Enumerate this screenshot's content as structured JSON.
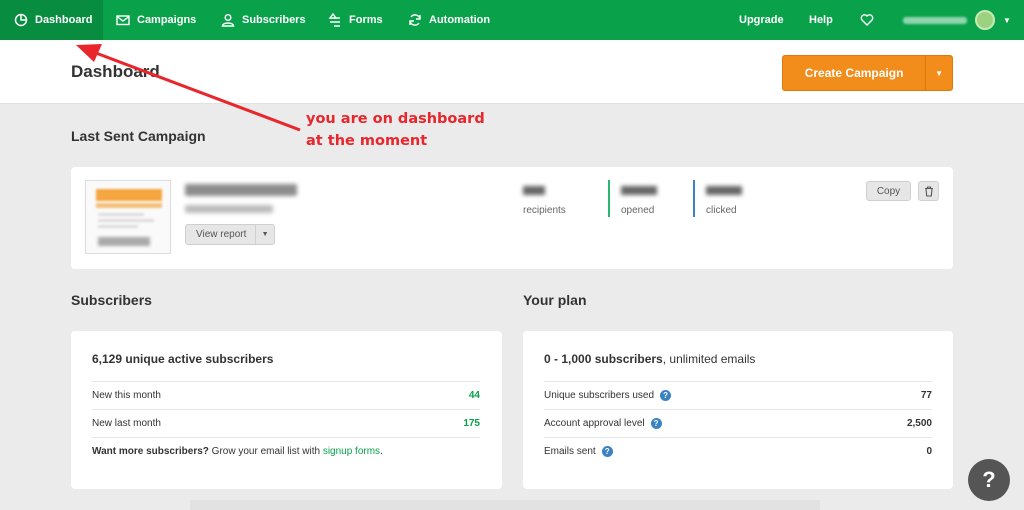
{
  "nav": {
    "items": [
      {
        "label": "Dashboard",
        "icon": "pie-chart-icon"
      },
      {
        "label": "Campaigns",
        "icon": "envelope-icon"
      },
      {
        "label": "Subscribers",
        "icon": "user-icon"
      },
      {
        "label": "Forms",
        "icon": "forms-icon"
      },
      {
        "label": "Automation",
        "icon": "sync-icon"
      }
    ],
    "upgrade": "Upgrade",
    "help": "Help",
    "heart_icon": "heart-icon",
    "caret_icon": "caret-down-icon"
  },
  "header": {
    "title": "Dashboard",
    "create_button": "Create Campaign"
  },
  "last_campaign": {
    "section_title": "Last Sent Campaign",
    "view_report": "View report",
    "stats": [
      {
        "label": "recipients",
        "color": "#ffffff"
      },
      {
        "label": "opened",
        "color": "#2bb673"
      },
      {
        "label": "clicked",
        "color": "#3b82c4"
      }
    ],
    "copy": "Copy"
  },
  "subscribers": {
    "section_title": "Subscribers",
    "headline": "6,129 unique active subscribers",
    "rows": [
      {
        "label": "New this month",
        "value": "44"
      },
      {
        "label": "New last month",
        "value": "175"
      }
    ],
    "cta_bold": "Want more subscribers?",
    "cta_text": " Grow your email list with ",
    "cta_link": "signup forms",
    "cta_end": "."
  },
  "plan": {
    "section_title": "Your plan",
    "headline_bold": "0 - 1,000 subscribers",
    "headline_rest": ", unlimited emails",
    "rows": [
      {
        "label": "Unique subscribers used",
        "value": "77"
      },
      {
        "label": "Account approval level",
        "value": "2,500"
      },
      {
        "label": "Emails sent",
        "value": "0"
      }
    ]
  },
  "annotation": {
    "line1": "you are on dashboard",
    "line2": "at the moment"
  },
  "help_fab": "?",
  "colors": {
    "nav_green": "#09a24b",
    "accent_orange": "#f28c1a",
    "annotation_red": "#e8262b"
  }
}
